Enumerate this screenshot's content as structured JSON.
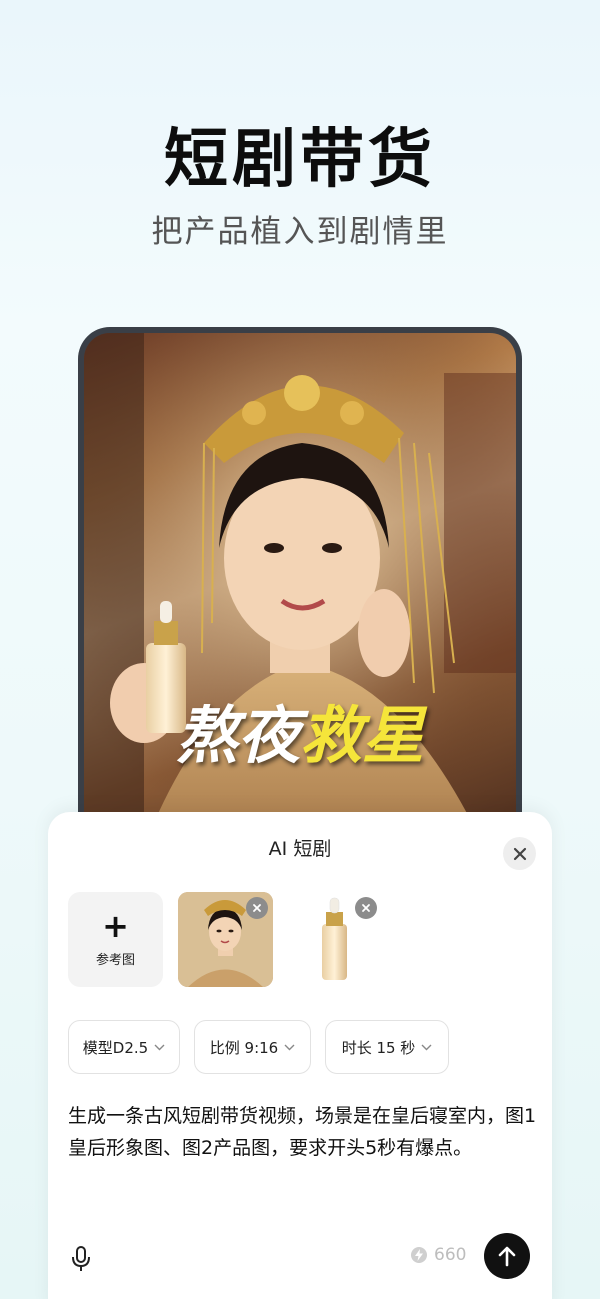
{
  "hero": {
    "title": "短剧带货",
    "subtitle": "把产品植入到剧情里"
  },
  "preview": {
    "caption_white": "熬夜",
    "caption_yellow": "救星"
  },
  "panel": {
    "title": "AI 短剧",
    "reference_button_label": "参考图",
    "chips": {
      "model": "模型D2.5",
      "ratio": "比例 9:16",
      "duration": "时长 15 秒"
    },
    "prompt_text": "生成一条古风短剧带货视频，场景是在皇后寝室内，图1皇后形象图、图2产品图，要求开头5秒有爆点。",
    "credits": "660"
  },
  "colors": {
    "caption_yellow": "#f5e53a",
    "send_button": "#111111",
    "phone_frame": "#3a3f47"
  },
  "icons": [
    "close-icon",
    "plus-icon",
    "remove-icon",
    "chevron-down-icon",
    "microphone-icon",
    "lightning-icon",
    "arrow-up-icon"
  ]
}
